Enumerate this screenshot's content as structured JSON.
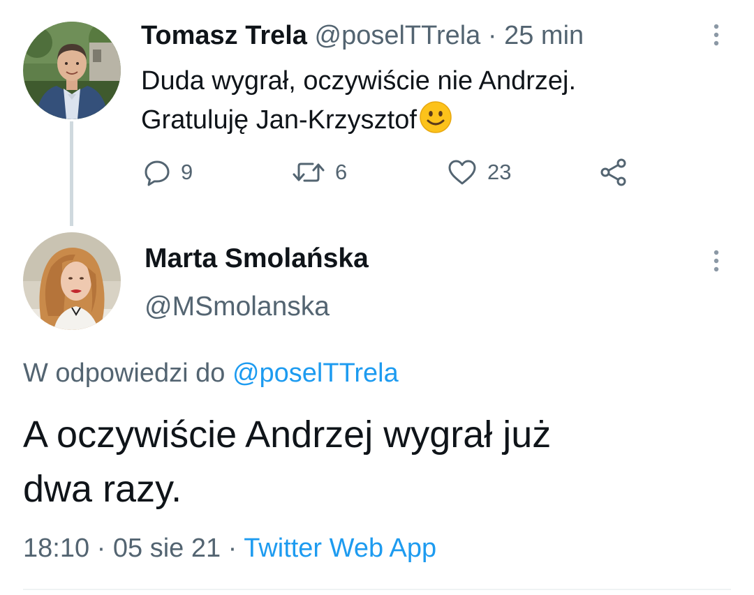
{
  "parent_tweet": {
    "author_name": "Tomasz Trela",
    "author_handle": "@poselTTrela",
    "separator": "·",
    "time_ago": "25 min",
    "text_line1": "Duda wygrał, oczywiście nie Andrzej.",
    "text_line2": "Gratuluję Jan-Krzysztof",
    "emoji": "slightly-smiling-face-emoji",
    "actions": {
      "reply_count": "9",
      "retweet_count": "6",
      "like_count": "23"
    },
    "icons": [
      "reply-icon",
      "retweet-icon",
      "like-icon",
      "share-icon",
      "more-options-icon"
    ]
  },
  "reply_tweet": {
    "author_name": "Marta Smolańska",
    "author_handle": "@MSmolanska",
    "replying_to_prefix": "W odpowiedzi do",
    "replying_to_handle": "@poselTTrela",
    "text_line1": "A oczywiście Andrzej wygrał już",
    "text_line2": "dwa razy.",
    "timestamp": "18:10 · 05 sie 21",
    "separator": "·",
    "source": "Twitter Web App"
  },
  "colors": {
    "text_primary": "#0f1419",
    "text_secondary": "#536471",
    "link": "#1d9bf0",
    "thread_line": "#cfd9de"
  }
}
